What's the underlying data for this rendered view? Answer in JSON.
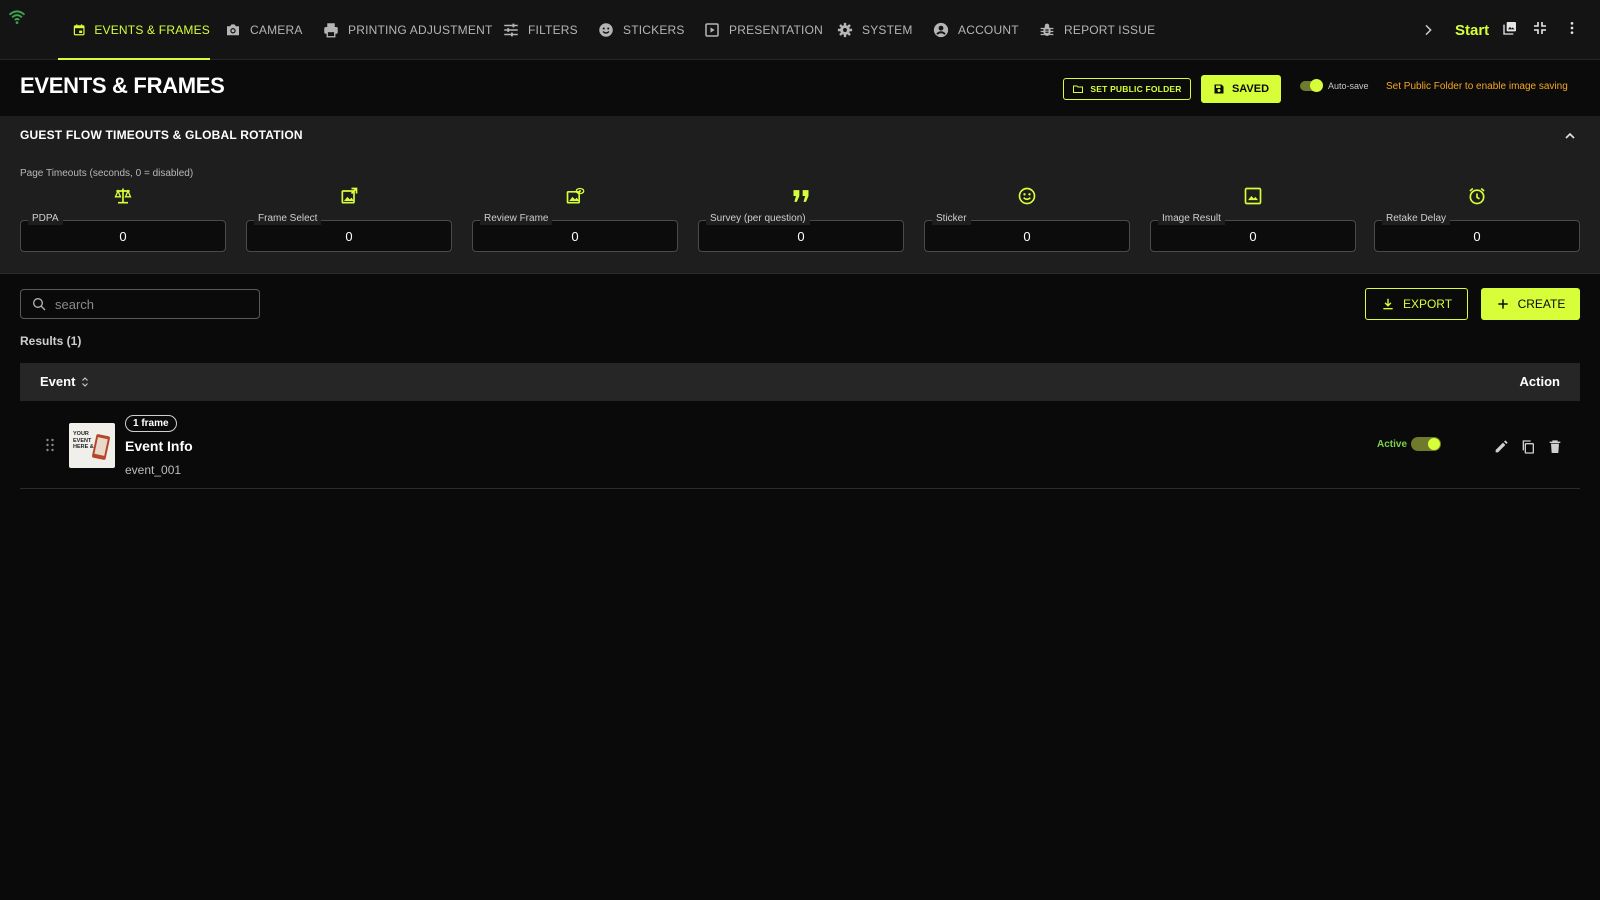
{
  "nav": {
    "tabs": [
      {
        "label": "EVENTS & FRAMES",
        "icon": "calendar-icon",
        "active": true
      },
      {
        "label": "CAMERA",
        "icon": "camera-icon"
      },
      {
        "label": "PRINTING ADJUSTMENT",
        "icon": "printer-icon"
      },
      {
        "label": "FILTERS",
        "icon": "sliders-icon"
      },
      {
        "label": "STICKERS",
        "icon": "smiley-icon"
      },
      {
        "label": "PRESENTATION",
        "icon": "play-icon"
      },
      {
        "label": "SYSTEM",
        "icon": "gear-icon"
      },
      {
        "label": "ACCOUNT",
        "icon": "account-icon"
      },
      {
        "label": "REPORT ISSUE",
        "icon": "bug-icon"
      }
    ],
    "start_label": "Start",
    "status_icon": "wifi-icon"
  },
  "header": {
    "title": "EVENTS & FRAMES",
    "set_folder_label": "SET PUBLIC FOLDER",
    "saved_label": "SAVED",
    "autosave_label": "Auto-save",
    "autosave_on": true,
    "warning": "Set Public Folder to enable image saving"
  },
  "timeouts": {
    "title": "GUEST FLOW TIMEOUTS & GLOBAL ROTATION",
    "subtitle": "Page Timeouts (seconds, 0 = disabled)",
    "fields": [
      {
        "label": "PDPA",
        "value": "0",
        "icon": "scale-icon"
      },
      {
        "label": "Frame Select",
        "value": "0",
        "icon": "image-edit-icon"
      },
      {
        "label": "Review Frame",
        "value": "0",
        "icon": "image-review-icon"
      },
      {
        "label": "Survey (per question)",
        "value": "0",
        "icon": "quote-icon"
      },
      {
        "label": "Sticker",
        "value": "0",
        "icon": "smiley-icon"
      },
      {
        "label": "Image Result",
        "value": "0",
        "icon": "image-icon"
      },
      {
        "label": "Retake Delay",
        "value": "0",
        "icon": "alarm-icon"
      }
    ]
  },
  "list": {
    "search_placeholder": "search",
    "export_label": "EXPORT",
    "create_label": "CREATE",
    "results_label": "Results (1)",
    "col_event": "Event",
    "col_action": "Action",
    "rows": [
      {
        "badge": "1 frame",
        "name": "Event Info",
        "id": "event_001",
        "status": "Active",
        "active": true,
        "thumb_text": "YOUR EVENT HERE &"
      }
    ]
  },
  "colors": {
    "accent": "#d7ff39",
    "warning": "#f5a623",
    "active_status": "#7cd14a",
    "background": "#0a0a0a",
    "panel": "#1e1e1e"
  }
}
